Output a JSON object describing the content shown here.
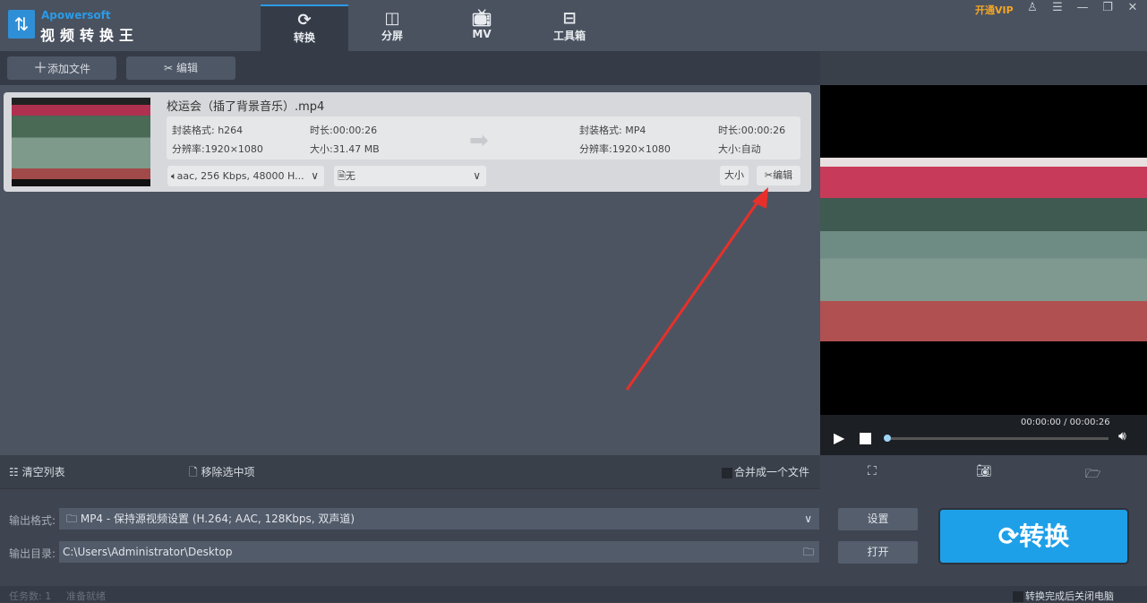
{
  "app": {
    "brand": "Apowersoft",
    "name": "视频转换王",
    "vip": "开通VIP"
  },
  "tabs": [
    {
      "label": "转换",
      "icon": "refresh-icon"
    },
    {
      "label": "分屏",
      "icon": "split-screen-icon"
    },
    {
      "label": "MV",
      "icon": "tv-icon"
    },
    {
      "label": "工具箱",
      "icon": "toolbox-icon"
    }
  ],
  "toolbar": {
    "add_file": "添加文件",
    "edit": "编辑"
  },
  "file": {
    "name": "校运会（插了背景音乐）.mp4",
    "source": {
      "format": "封装格式: h264",
      "duration": "时长:00:00:26",
      "resolution": "分辨率:1920×1080",
      "size": "大小:31.47 MB"
    },
    "target": {
      "format": "封装格式: MP4",
      "duration": "时长:00:00:26",
      "resolution": "分辨率:1920×1080",
      "size": "大小:自动"
    },
    "audio": "aac, 256 Kbps, 48000 H...",
    "subtitle": "无",
    "size_btn": "大小",
    "edit_btn": "编辑"
  },
  "player": {
    "time": "00:00:00 / 00:00:26",
    "progress": 0
  },
  "actions": {
    "clear": "清空列表",
    "remove": "移除选中项",
    "merge": "合并成一个文件"
  },
  "output": {
    "format_label": "输出格式:",
    "format_value": "MP4 - 保持源视频设置 (H.264; AAC, 128Kbps, 双声道)",
    "dir_label": "输出目录:",
    "dir_value": "C:\\Users\\Administrator\\Desktop",
    "settings": "设置",
    "open": "打开",
    "convert": "转换"
  },
  "status": {
    "tasks": "任务数: 1",
    "state": "准备就绪",
    "shutdown": "转换完成后关闭电脑"
  }
}
